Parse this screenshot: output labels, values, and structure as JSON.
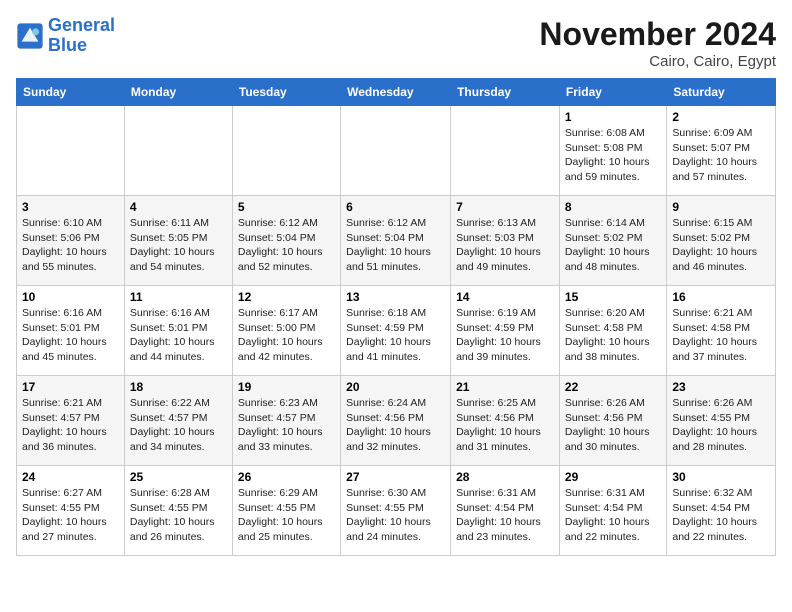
{
  "header": {
    "logo_line1": "General",
    "logo_line2": "Blue",
    "month": "November 2024",
    "location": "Cairo, Cairo, Egypt"
  },
  "weekdays": [
    "Sunday",
    "Monday",
    "Tuesday",
    "Wednesday",
    "Thursday",
    "Friday",
    "Saturday"
  ],
  "weeks": [
    [
      {
        "day": "",
        "info": ""
      },
      {
        "day": "",
        "info": ""
      },
      {
        "day": "",
        "info": ""
      },
      {
        "day": "",
        "info": ""
      },
      {
        "day": "",
        "info": ""
      },
      {
        "day": "1",
        "info": "Sunrise: 6:08 AM\nSunset: 5:08 PM\nDaylight: 10 hours and 59 minutes."
      },
      {
        "day": "2",
        "info": "Sunrise: 6:09 AM\nSunset: 5:07 PM\nDaylight: 10 hours and 57 minutes."
      }
    ],
    [
      {
        "day": "3",
        "info": "Sunrise: 6:10 AM\nSunset: 5:06 PM\nDaylight: 10 hours and 55 minutes."
      },
      {
        "day": "4",
        "info": "Sunrise: 6:11 AM\nSunset: 5:05 PM\nDaylight: 10 hours and 54 minutes."
      },
      {
        "day": "5",
        "info": "Sunrise: 6:12 AM\nSunset: 5:04 PM\nDaylight: 10 hours and 52 minutes."
      },
      {
        "day": "6",
        "info": "Sunrise: 6:12 AM\nSunset: 5:04 PM\nDaylight: 10 hours and 51 minutes."
      },
      {
        "day": "7",
        "info": "Sunrise: 6:13 AM\nSunset: 5:03 PM\nDaylight: 10 hours and 49 minutes."
      },
      {
        "day": "8",
        "info": "Sunrise: 6:14 AM\nSunset: 5:02 PM\nDaylight: 10 hours and 48 minutes."
      },
      {
        "day": "9",
        "info": "Sunrise: 6:15 AM\nSunset: 5:02 PM\nDaylight: 10 hours and 46 minutes."
      }
    ],
    [
      {
        "day": "10",
        "info": "Sunrise: 6:16 AM\nSunset: 5:01 PM\nDaylight: 10 hours and 45 minutes."
      },
      {
        "day": "11",
        "info": "Sunrise: 6:16 AM\nSunset: 5:01 PM\nDaylight: 10 hours and 44 minutes."
      },
      {
        "day": "12",
        "info": "Sunrise: 6:17 AM\nSunset: 5:00 PM\nDaylight: 10 hours and 42 minutes."
      },
      {
        "day": "13",
        "info": "Sunrise: 6:18 AM\nSunset: 4:59 PM\nDaylight: 10 hours and 41 minutes."
      },
      {
        "day": "14",
        "info": "Sunrise: 6:19 AM\nSunset: 4:59 PM\nDaylight: 10 hours and 39 minutes."
      },
      {
        "day": "15",
        "info": "Sunrise: 6:20 AM\nSunset: 4:58 PM\nDaylight: 10 hours and 38 minutes."
      },
      {
        "day": "16",
        "info": "Sunrise: 6:21 AM\nSunset: 4:58 PM\nDaylight: 10 hours and 37 minutes."
      }
    ],
    [
      {
        "day": "17",
        "info": "Sunrise: 6:21 AM\nSunset: 4:57 PM\nDaylight: 10 hours and 36 minutes."
      },
      {
        "day": "18",
        "info": "Sunrise: 6:22 AM\nSunset: 4:57 PM\nDaylight: 10 hours and 34 minutes."
      },
      {
        "day": "19",
        "info": "Sunrise: 6:23 AM\nSunset: 4:57 PM\nDaylight: 10 hours and 33 minutes."
      },
      {
        "day": "20",
        "info": "Sunrise: 6:24 AM\nSunset: 4:56 PM\nDaylight: 10 hours and 32 minutes."
      },
      {
        "day": "21",
        "info": "Sunrise: 6:25 AM\nSunset: 4:56 PM\nDaylight: 10 hours and 31 minutes."
      },
      {
        "day": "22",
        "info": "Sunrise: 6:26 AM\nSunset: 4:56 PM\nDaylight: 10 hours and 30 minutes."
      },
      {
        "day": "23",
        "info": "Sunrise: 6:26 AM\nSunset: 4:55 PM\nDaylight: 10 hours and 28 minutes."
      }
    ],
    [
      {
        "day": "24",
        "info": "Sunrise: 6:27 AM\nSunset: 4:55 PM\nDaylight: 10 hours and 27 minutes."
      },
      {
        "day": "25",
        "info": "Sunrise: 6:28 AM\nSunset: 4:55 PM\nDaylight: 10 hours and 26 minutes."
      },
      {
        "day": "26",
        "info": "Sunrise: 6:29 AM\nSunset: 4:55 PM\nDaylight: 10 hours and 25 minutes."
      },
      {
        "day": "27",
        "info": "Sunrise: 6:30 AM\nSunset: 4:55 PM\nDaylight: 10 hours and 24 minutes."
      },
      {
        "day": "28",
        "info": "Sunrise: 6:31 AM\nSunset: 4:54 PM\nDaylight: 10 hours and 23 minutes."
      },
      {
        "day": "29",
        "info": "Sunrise: 6:31 AM\nSunset: 4:54 PM\nDaylight: 10 hours and 22 minutes."
      },
      {
        "day": "30",
        "info": "Sunrise: 6:32 AM\nSunset: 4:54 PM\nDaylight: 10 hours and 22 minutes."
      }
    ]
  ]
}
